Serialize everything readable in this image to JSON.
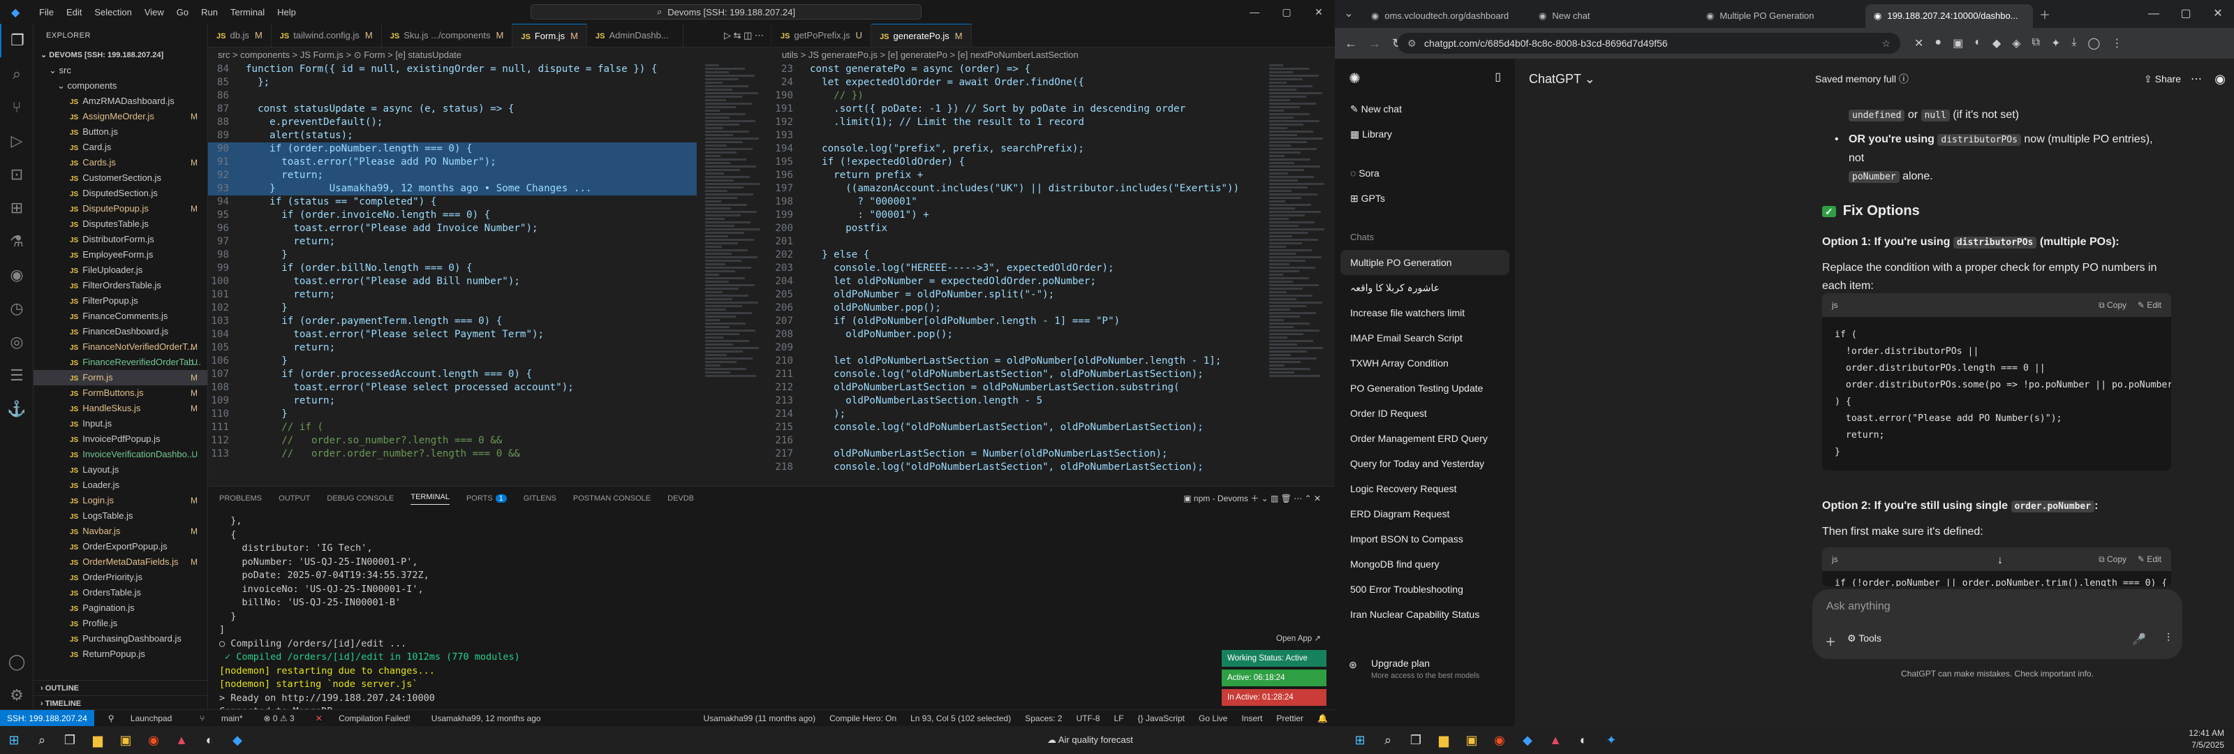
{
  "vscode": {
    "menu": [
      "File",
      "Edit",
      "Selection",
      "View",
      "Go",
      "Run",
      "Terminal",
      "Help"
    ],
    "search": "Devoms [SSH: 199.188.207.24]",
    "explorer_title": "EXPLORER",
    "workspace": "DEVOMS [SSH: 199.188.207.24]",
    "folders": [
      "src",
      "components"
    ],
    "files": [
      {
        "name": "AmzRMADashboard.js",
        "mark": "",
        "color": "#cccccc"
      },
      {
        "name": "AssignMeOrder.js",
        "mark": "M",
        "color": "#e2c08d"
      },
      {
        "name": "Button.js",
        "mark": "",
        "color": "#cccccc"
      },
      {
        "name": "Card.js",
        "mark": "",
        "color": "#cccccc"
      },
      {
        "name": "Cards.js",
        "mark": "M",
        "color": "#e2c08d"
      },
      {
        "name": "CustomerSection.js",
        "mark": "",
        "color": "#cccccc"
      },
      {
        "name": "DisputedSection.js",
        "mark": "",
        "color": "#cccccc"
      },
      {
        "name": "DisputePopup.js",
        "mark": "M",
        "color": "#e2c08d"
      },
      {
        "name": "DisputesTable.js",
        "mark": "",
        "color": "#cccccc"
      },
      {
        "name": "DistributorForm.js",
        "mark": "",
        "color": "#cccccc"
      },
      {
        "name": "EmployeeForm.js",
        "mark": "",
        "color": "#cccccc"
      },
      {
        "name": "FileUploader.js",
        "mark": "",
        "color": "#cccccc"
      },
      {
        "name": "FilterOrdersTable.js",
        "mark": "",
        "color": "#cccccc"
      },
      {
        "name": "FilterPopup.js",
        "mark": "",
        "color": "#cccccc"
      },
      {
        "name": "FinanceComments.js",
        "mark": "",
        "color": "#cccccc"
      },
      {
        "name": "FinanceDashboard.js",
        "mark": "",
        "color": "#cccccc"
      },
      {
        "name": "FinanceNotVerifiedOrderT...",
        "mark": "M",
        "color": "#e2c08d"
      },
      {
        "name": "FinanceReverifiedOrderTab...",
        "mark": "U",
        "color": "#73c991"
      },
      {
        "name": "Form.js",
        "mark": "M",
        "color": "#e2c08d",
        "selected": true
      },
      {
        "name": "FormButtons.js",
        "mark": "M",
        "color": "#e2c08d"
      },
      {
        "name": "HandleSkus.js",
        "mark": "M",
        "color": "#e2c08d"
      },
      {
        "name": "Input.js",
        "mark": "",
        "color": "#cccccc"
      },
      {
        "name": "InvoicePdfPopup.js",
        "mark": "",
        "color": "#cccccc"
      },
      {
        "name": "InvoiceVerificationDashbo...",
        "mark": "U",
        "color": "#73c991"
      },
      {
        "name": "Layout.js",
        "mark": "",
        "color": "#cccccc"
      },
      {
        "name": "Loader.js",
        "mark": "",
        "color": "#cccccc"
      },
      {
        "name": "Login.js",
        "mark": "M",
        "color": "#e2c08d"
      },
      {
        "name": "LogsTable.js",
        "mark": "",
        "color": "#cccccc"
      },
      {
        "name": "Navbar.js",
        "mark": "M",
        "color": "#e2c08d"
      },
      {
        "name": "OrderExportPopup.js",
        "mark": "",
        "color": "#cccccc"
      },
      {
        "name": "OrderMetaDataFields.js",
        "mark": "M",
        "color": "#e2c08d"
      },
      {
        "name": "OrderPriority.js",
        "mark": "",
        "color": "#cccccc"
      },
      {
        "name": "OrdersTable.js",
        "mark": "",
        "color": "#cccccc"
      },
      {
        "name": "Pagination.js",
        "mark": "",
        "color": "#cccccc"
      },
      {
        "name": "Profile.js",
        "mark": "",
        "color": "#cccccc"
      },
      {
        "name": "PurchasingDashboard.js",
        "mark": "",
        "color": "#cccccc"
      },
      {
        "name": "ReturnPopup.js",
        "mark": "",
        "color": "#cccccc"
      }
    ],
    "outline": "OUTLINE",
    "timeline": "TIMELINE",
    "left_tabs": [
      {
        "label": "db.js",
        "mark": "M",
        "active": false
      },
      {
        "label": "tailwind.config.js",
        "mark": "M",
        "active": false
      },
      {
        "label": "Sku.js .../components",
        "mark": "M",
        "active": false
      },
      {
        "label": "Form.js",
        "mark": "M",
        "active": true
      },
      {
        "label": "AdminDashb...",
        "mark": "",
        "active": false
      }
    ],
    "right_tabs": [
      {
        "label": "getPoPrefix.js",
        "mark": "U",
        "active": false
      },
      {
        "label": "generatePo.js",
        "mark": "M",
        "active": true
      }
    ],
    "left_crumbs": "src > components > JS Form.js > ⊙ Form > [e] statusUpdate",
    "right_crumbs": "utils > JS generatePo.js > [e] generatePo > [e] nextPoNumberLastSection",
    "left_code": [
      {
        "n": "84",
        "t": "function Form({ id = null, existingOrder = null, dispute = false }) {"
      },
      {
        "n": "85",
        "t": "  };"
      },
      {
        "n": "86",
        "t": ""
      },
      {
        "n": "87",
        "t": "  const statusUpdate = async (e, status) => {"
      },
      {
        "n": "88",
        "t": "    e.preventDefault();"
      },
      {
        "n": "89",
        "t": "    alert(status);"
      },
      {
        "n": "90",
        "t": "    if (order.poNumber.length === 0) {",
        "hl": true
      },
      {
        "n": "91",
        "t": "      toast.error(\"Please add PO Number\");",
        "hl": true
      },
      {
        "n": "92",
        "t": "      return;",
        "hl": true
      },
      {
        "n": "93",
        "t": "    }         Usamakha99, 12 months ago • Some Changes ...",
        "hl": true
      },
      {
        "n": "94",
        "t": "    if (status == \"completed\") {"
      },
      {
        "n": "95",
        "t": "      if (order.invoiceNo.length === 0) {"
      },
      {
        "n": "96",
        "t": "        toast.error(\"Please add Invoice Number\");"
      },
      {
        "n": "97",
        "t": "        return;"
      },
      {
        "n": "98",
        "t": "      }"
      },
      {
        "n": "99",
        "t": "      if (order.billNo.length === 0) {"
      },
      {
        "n": "100",
        "t": "        toast.error(\"Please add Bill number\");"
      },
      {
        "n": "101",
        "t": "        return;"
      },
      {
        "n": "102",
        "t": "      }"
      },
      {
        "n": "103",
        "t": "      if (order.paymentTerm.length === 0) {"
      },
      {
        "n": "104",
        "t": "        toast.error(\"Please select Payment Term\");"
      },
      {
        "n": "105",
        "t": "        return;"
      },
      {
        "n": "106",
        "t": "      }"
      },
      {
        "n": "107",
        "t": "      if (order.processedAccount.length === 0) {"
      },
      {
        "n": "108",
        "t": "        toast.error(\"Please select processed account\");"
      },
      {
        "n": "109",
        "t": "        return;"
      },
      {
        "n": "110",
        "t": "      }"
      },
      {
        "n": "111",
        "t": "      // if ("
      },
      {
        "n": "112",
        "t": "      //   order.so_number?.length === 0 &&"
      },
      {
        "n": "113",
        "t": "      //   order.order_number?.length === 0 &&"
      }
    ],
    "right_code": [
      {
        "n": "23",
        "t": "const generatePo = async (order) => {"
      },
      {
        "n": "24",
        "t": "  let expectedOldOrder = await Order.findOne({"
      },
      {
        "n": "190",
        "t": "    // })"
      },
      {
        "n": "191",
        "t": "    .sort({ poDate: -1 }) // Sort by poDate in descending order"
      },
      {
        "n": "192",
        "t": "    .limit(1); // Limit the result to 1 record"
      },
      {
        "n": "193",
        "t": ""
      },
      {
        "n": "194",
        "t": "  console.log(\"prefix\", prefix, searchPrefix);"
      },
      {
        "n": "195",
        "t": "  if (!expectedOldOrder) {"
      },
      {
        "n": "196",
        "t": "    return prefix +"
      },
      {
        "n": "197",
        "t": "      ((amazonAccount.includes(\"UK\") || distributor.includes(\"Exertis\"))"
      },
      {
        "n": "198",
        "t": "        ? \"000001\""
      },
      {
        "n": "199",
        "t": "        : \"00001\") +"
      },
      {
        "n": "200",
        "t": "      postfix"
      },
      {
        "n": "201",
        "t": ""
      },
      {
        "n": "202",
        "t": "  } else {"
      },
      {
        "n": "203",
        "t": "    console.log(\"HEREEE----->3\", expectedOldOrder);"
      },
      {
        "n": "204",
        "t": "    let oldPoNumber = expectedOldOrder.poNumber;"
      },
      {
        "n": "205",
        "t": "    oldPoNumber = oldPoNumber.split(\"-\");"
      },
      {
        "n": "206",
        "t": "    oldPoNumber.pop();"
      },
      {
        "n": "207",
        "t": "    if (oldPoNumber[oldPoNumber.length - 1] === \"P\")"
      },
      {
        "n": "208",
        "t": "      oldPoNumber.pop();"
      },
      {
        "n": "209",
        "t": ""
      },
      {
        "n": "210",
        "t": "    let oldPoNumberLastSection = oldPoNumber[oldPoNumber.length - 1];"
      },
      {
        "n": "211",
        "t": "    console.log(\"oldPoNumberLastSection\", oldPoNumberLastSection);"
      },
      {
        "n": "212",
        "t": "    oldPoNumberLastSection = oldPoNumberLastSection.substring("
      },
      {
        "n": "213",
        "t": "      oldPoNumberLastSection.length - 5"
      },
      {
        "n": "214",
        "t": "    );"
      },
      {
        "n": "215",
        "t": "    console.log(\"oldPoNumberLastSection\", oldPoNumberLastSection);"
      },
      {
        "n": "216",
        "t": ""
      },
      {
        "n": "217",
        "t": "    oldPoNumberLastSection = Number(oldPoNumberLastSection);"
      },
      {
        "n": "218",
        "t": "    console.log(\"oldPoNumberLastSection\", oldPoNumberLastSection);"
      }
    ],
    "panel_tabs": [
      "PROBLEMS",
      "OUTPUT",
      "DEBUG CONSOLE",
      "TERMINAL",
      "PORTS",
      "GITLENS",
      "POSTMAN CONSOLE",
      "DEVDB"
    ],
    "ports_badge": "1",
    "terminal_label": "npm - Devoms",
    "terminal_lines": [
      "  },",
      "  {",
      "    distributor: 'IG Tech',",
      "    poNumber: 'US-QJ-25-IN00001-P',",
      "    poDate: 2025-07-04T19:34:55.372Z,",
      "    invoiceNo: 'US-QJ-25-IN00001-I',",
      "    billNo: 'US-QJ-25-IN00001-B'",
      "  }",
      "]",
      "○ Compiling /orders/[id]/edit ...",
      " ✓ Compiled /orders/[id]/edit in 1012ms (770 modules)",
      "[nodemon] restarting due to changes...",
      "[nodemon] starting `node server.js`",
      "> Ready on http://199.188.207.24:10000",
      "Connected to MongoDB",
      "▯"
    ],
    "open_app": "Open App ↗",
    "status_overlay": [
      {
        "label": "Working Status: Active",
        "color": "#16825d"
      },
      {
        "label": "Active: 06:18:24",
        "color": "#2ea043"
      },
      {
        "label": "In Active: 01:28:24",
        "color": "#c93c37"
      }
    ],
    "statusbar": {
      "remote": "SSH: 199.188.207.24",
      "branch": "main*",
      "errors": "⊗ 0  ⚠ 3",
      "compilation": "Compilation Failed!",
      "blame": "Usamakha99, 12 months ago",
      "blame2": "Usamakha99 (11 months ago)",
      "compile_hero": "Compile Hero: On",
      "position": "Ln 93, Col 5 (102 selected)",
      "spaces": "Spaces: 2",
      "encoding": "UTF-8",
      "eol": "LF",
      "language": "{} JavaScript",
      "golive": "Go Live",
      "insert": "Insert",
      "prettier": "Prettier"
    },
    "taskbar_weather": "Air quality forecast",
    "launchpad": "Launchpad"
  },
  "chrome": {
    "tabs": [
      {
        "label": "oms.vcloudtech.org/dashboard",
        "active": false
      },
      {
        "label": "New chat",
        "active": false
      },
      {
        "label": "Multiple PO Generation",
        "active": false
      },
      {
        "label": "199.188.207.24:10000/dashbo...",
        "active": true
      }
    ],
    "url": "chatgpt.com/c/685d4b0f-8c8c-8008-b3cd-8696d7d49f56"
  },
  "chatgpt": {
    "sidebar_items": [
      "New chat",
      "Library",
      "Sora",
      "GPTs"
    ],
    "chats_label": "Chats",
    "chats": [
      "Multiple PO Generation",
      "عاشورہ کربلا کا واقعہ",
      "Increase file watchers limit",
      "IMAP Email Search Script",
      "TXWH Array Condition",
      "PO Generation Testing Update",
      "Order ID Request",
      "Order Management ERD Query",
      "Query for Today and Yesterday",
      "Logic Recovery Request",
      "ERD Diagram Request",
      "Import BSON to Compass",
      "MongoDB find query",
      "500 Error Troubleshooting",
      "Iran Nuclear Capability Status"
    ],
    "upgrade": "Upgrade plan",
    "upgrade_sub": "More access to the best models",
    "model": "ChatGPT ⌄",
    "memory": "Saved memory full ⓘ",
    "share": "Share",
    "bullet1_code1": "undefined",
    "bullet1_or": " or ",
    "bullet1_code2": "null",
    "bullet1_rest": " (if it's not set)",
    "bullet2_pre": "OR you're using ",
    "bullet2_code": "distributorPOs",
    "bullet2_rest": " now (multiple PO entries), not",
    "bullet2_code2": "poNumber",
    "bullet2_end": " alone.",
    "fix_heading": "Fix Options",
    "opt1_pre": "Option 1: If you're using ",
    "opt1_code": "distributorPOs",
    "opt1_rest": " (multiple POs):",
    "opt1_desc": "Replace the condition with a proper check for empty PO numbers in each item:",
    "code_lang": "js",
    "copy": "Copy",
    "edit": "Edit",
    "code1": "if (\n  !order.distributorPOs ||\n  order.distributorPOs.length === 0 ||\n  order.distributorPOs.some(po => !po.poNumber || po.poNumber.tri\n) {\n  toast.error(\"Please add PO Number(s)\");\n  return;\n}",
    "opt2_pre": "Option 2: If you're still using single ",
    "opt2_code": "order.poNumber",
    "opt2_rest": ":",
    "opt2_desc": "Then first make sure it's defined:",
    "code2": "if (!order.poNumber || order.poNumber.trim().length === 0) {",
    "ask": "Ask anything",
    "tools": "Tools",
    "disclaimer": "ChatGPT can make mistakes. Check important info."
  },
  "clock": {
    "time": "12:41 AM",
    "date": "7/5/2025"
  }
}
